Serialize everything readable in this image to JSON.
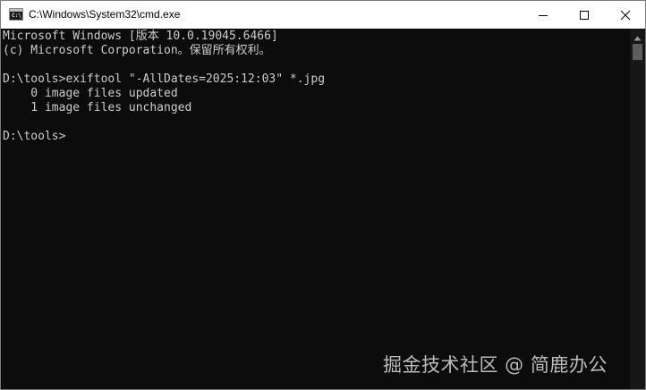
{
  "window": {
    "title": "C:\\Windows\\System32\\cmd.exe",
    "app_icon": "cmd-icon",
    "app_icon_glyph": "C:\\",
    "controls": {
      "minimize_icon": "minimize-icon",
      "maximize_icon": "maximize-icon",
      "close_icon": "close-icon"
    }
  },
  "console": {
    "lines": [
      "Microsoft Windows [版本 10.0.19045.6466]",
      "(c) Microsoft Corporation。保留所有权利。",
      "",
      "D:\\tools>exiftool \"-AllDates=2025:12:03\" *.jpg",
      "    0 image files updated",
      "    1 image files unchanged",
      "",
      "D:\\tools>"
    ]
  },
  "watermark": "掘金技术社区 @ 简鹿办公",
  "colors": {
    "console_background": "#0c0c0c",
    "console_text": "#cccccc",
    "titlebar_background": "#ffffff"
  }
}
